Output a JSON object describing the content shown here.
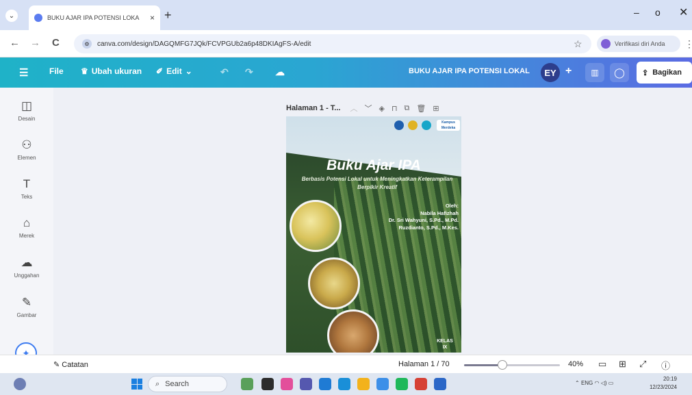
{
  "browser": {
    "tab_title": "BUKU AJAR IPA POTENSI LOKA",
    "tab_close": "×",
    "new_tab": "+",
    "url": "canva.com/design/DAGQMFG7JQk/FCVPGUb2a6p48DKIAgFS-A/edit",
    "profile_label": "Verifikasi diri Anda",
    "nav": {
      "back": "←",
      "forward": "→",
      "reload": "C"
    },
    "window": {
      "min": "–",
      "max": "o",
      "close": "✕"
    }
  },
  "toolbar": {
    "file": "File",
    "resize": "Ubah ukuran",
    "edit": "Edit",
    "project_title": "BUKU AJAR IPA POTENSI LOKAL",
    "avatar_initials": "EY",
    "share": "Bagikan"
  },
  "sidebar": {
    "items": [
      {
        "label": "Desain",
        "icon": "design-icon",
        "glyph": "◫"
      },
      {
        "label": "Elemen",
        "icon": "elements-icon",
        "glyph": "⚇"
      },
      {
        "label": "Teks",
        "icon": "text-icon",
        "glyph": "T"
      },
      {
        "label": "Merek",
        "icon": "brand-icon",
        "glyph": "⌂"
      },
      {
        "label": "Unggahan",
        "icon": "upload-icon",
        "glyph": "☁"
      },
      {
        "label": "Gambar",
        "icon": "draw-icon",
        "glyph": "✎"
      }
    ]
  },
  "page": {
    "header_title": "Halaman 1 - T..."
  },
  "cover": {
    "title": "Buku Ajar IPA",
    "subtitle": "Berbasis Potensi Lokal untuk Meningkatkan Keterampilan Berpikir Kreatif",
    "author_lines": [
      "Oleh:",
      "Nabila Hafizhah",
      "Dr. Sri Wahyuni, S.Pd., M.Pd.",
      "Ruzdianto, S.Pd., M.Kes."
    ],
    "kelas_lines": [
      "KELAS",
      "IX"
    ],
    "logo_text": "Kampus Merdeka"
  },
  "status": {
    "notes": "Catatan",
    "page_count": "Halaman 1 / 70",
    "zoom": "40%",
    "zoom_level": 0.4
  },
  "taskbar": {
    "search_placeholder": "Search",
    "lang": "ENG",
    "time": "20:19",
    "date": "12/23/2024"
  },
  "colors": {
    "canva_start": "#1fb2c8",
    "canva_end": "#5b6be3",
    "cover_green": "#2c4a2c"
  }
}
